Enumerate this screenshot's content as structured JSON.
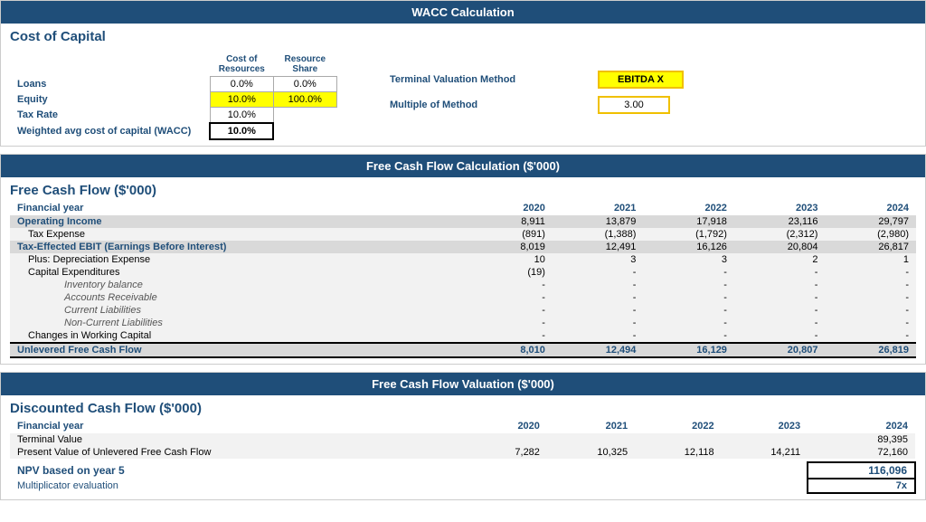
{
  "wacc_header": "WACC Calculation",
  "cost_of_capital_title": "Cost of Capital",
  "col_headers": {
    "cost_of_resources": "Cost of Resources",
    "resource_share": "Resource Share"
  },
  "coc_rows": [
    {
      "label": "Loans",
      "cost": "0.0%",
      "share": "0.0%",
      "cost_highlight": "white",
      "share_highlight": "white"
    },
    {
      "label": "Equity",
      "cost": "10.0%",
      "share": "100.0%",
      "cost_highlight": "yellow",
      "share_highlight": "yellow"
    },
    {
      "label": "Tax Rate",
      "cost": "10.0%",
      "share": "",
      "cost_highlight": "white",
      "share_highlight": "none"
    },
    {
      "label": "Weighted avg cost of capital (WACC)",
      "cost": "10.0%",
      "share": "",
      "cost_highlight": "bold",
      "share_highlight": "none"
    }
  ],
  "terminal_valuation_label": "Terminal Valuation Method",
  "terminal_valuation_value": "EBITDA X",
  "multiple_of_method_label": "Multiple of Method",
  "multiple_of_method_value": "3.00",
  "fcf_header": "Free Cash Flow Calculation ($'000)",
  "fcf_title": "Free Cash Flow ($'000)",
  "fcf_year_label": "Financial year",
  "fcf_years": [
    "2020",
    "2021",
    "2022",
    "2023",
    "2024"
  ],
  "fcf_rows": [
    {
      "label": "Operating Income",
      "indent": 0,
      "bold": true,
      "style": "gray",
      "values": [
        "8,911",
        "13,879",
        "17,918",
        "23,116",
        "29,797"
      ]
    },
    {
      "label": "Tax Expense",
      "indent": 1,
      "bold": false,
      "style": "light",
      "values": [
        "(891)",
        "(1,388)",
        "(1,792)",
        "(2,312)",
        "(2,980)"
      ]
    },
    {
      "label": "Tax-Effected EBIT (Earnings Before Interest)",
      "indent": 0,
      "bold": true,
      "style": "gray",
      "values": [
        "8,019",
        "12,491",
        "16,126",
        "20,804",
        "26,817"
      ]
    },
    {
      "label": "Plus: Depreciation Expense",
      "indent": 1,
      "bold": false,
      "style": "light",
      "values": [
        "10",
        "3",
        "3",
        "2",
        "1"
      ]
    },
    {
      "label": "Capital Expenditures",
      "indent": 1,
      "bold": false,
      "style": "light",
      "values": [
        "(19)",
        "-",
        "-",
        "-",
        "-"
      ]
    },
    {
      "label": "Inventory balance",
      "indent": 2,
      "bold": false,
      "style": "light",
      "values": [
        "-",
        "-",
        "-",
        "-",
        "-"
      ]
    },
    {
      "label": "Accounts Receivable",
      "indent": 2,
      "bold": false,
      "style": "light",
      "values": [
        "-",
        "-",
        "-",
        "-",
        "-"
      ]
    },
    {
      "label": "Current Liabilities",
      "indent": 2,
      "bold": false,
      "style": "light",
      "values": [
        "-",
        "-",
        "-",
        "-",
        "-"
      ]
    },
    {
      "label": "Non-Current Liabilities",
      "indent": 2,
      "bold": false,
      "style": "light",
      "values": [
        "-",
        "-",
        "-",
        "-",
        "-"
      ]
    },
    {
      "label": "Changes in Working Capital",
      "indent": 1,
      "bold": false,
      "style": "light",
      "values": [
        "-",
        "-",
        "-",
        "-",
        "-"
      ]
    },
    {
      "label": "Unlevered Free Cash Flow",
      "indent": 0,
      "bold": true,
      "style": "total",
      "values": [
        "8,010",
        "12,494",
        "16,129",
        "20,807",
        "26,819"
      ]
    }
  ],
  "val_header": "Free Cash Flow Valuation ($'000)",
  "val_title": "Discounted Cash Flow ($'000)",
  "val_year_label": "Financial year",
  "val_years": [
    "2020",
    "2021",
    "2022",
    "2023",
    "2024"
  ],
  "val_rows": [
    {
      "label": "Terminal Value",
      "bold": false,
      "style": "light",
      "values": [
        "",
        "",
        "",
        "",
        "89,395"
      ]
    },
    {
      "label": "Present Value of Unlevered Free Cash Flow",
      "bold": false,
      "style": "light",
      "values": [
        "7,282",
        "10,325",
        "12,118",
        "14,211",
        "72,160"
      ]
    }
  ],
  "npv_label": "NPV based on year 5",
  "npv_value": "116,096",
  "mult_label": "Multiplicator evaluation",
  "mult_value": "7x"
}
